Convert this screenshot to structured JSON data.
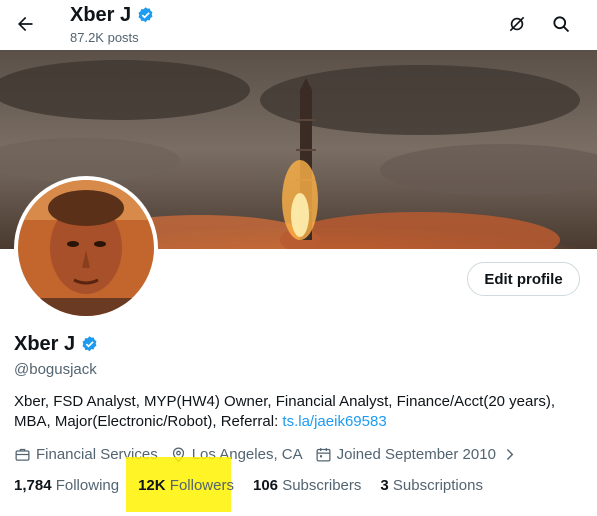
{
  "header": {
    "title": "Xber J",
    "posts_count": "87.2K posts",
    "icons": [
      "back-arrow-icon",
      "grok-icon",
      "search-icon"
    ]
  },
  "profile": {
    "name": "Xber J",
    "handle": "@bogusjack",
    "edit_button_label": "Edit profile",
    "bio_text": "Xber, FSD Analyst, MYP(HW4) Owner, Financial Analyst, Finance/Acct(20 years), MBA, Major(Electronic/Robot), Referral: ",
    "bio_link": "ts.la/jaeik69583",
    "category": "Financial Services",
    "location": "Los Angeles, CA",
    "joined": "Joined September 2010"
  },
  "stats": {
    "following_count": "1,784",
    "following_label": "Following",
    "followers_count": "12K",
    "followers_label": "Followers",
    "subscribers_count": "106",
    "subscribers_label": "Subscribers",
    "subscriptions_count": "3",
    "subscriptions_label": "Subscriptions"
  },
  "colors": {
    "verified": "#1d9bf0",
    "link": "#1d9bf0",
    "secondary_text": "#536471",
    "highlight": "#fff200"
  }
}
